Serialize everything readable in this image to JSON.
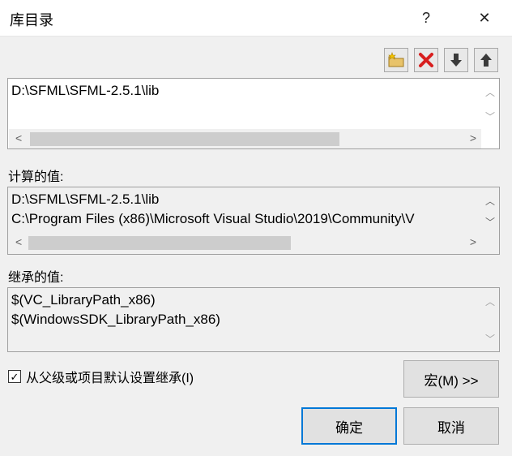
{
  "window": {
    "title": "库目录",
    "help_label": "?",
    "close_label": "✕"
  },
  "toolbar": {
    "icons": [
      "new-folder-icon",
      "delete-icon",
      "move-down-icon",
      "move-up-icon"
    ],
    "delete_color": "#d81e1e"
  },
  "edit_box": {
    "lines": [
      "D:\\SFML\\SFML-2.5.1\\lib"
    ]
  },
  "computed": {
    "label": "计算的值:",
    "lines": [
      "D:\\SFML\\SFML-2.5.1\\lib",
      "C:\\Program Files (x86)\\Microsoft Visual Studio\\2019\\Community\\V"
    ]
  },
  "inherited": {
    "label": "继承的值:",
    "lines": [
      "$(VC_LibraryPath_x86)",
      "$(WindowsSDK_LibraryPath_x86)"
    ]
  },
  "inherit_checkbox": {
    "label": "从父级或项目默认设置继承(I)",
    "checked": true,
    "mark": "✓"
  },
  "buttons": {
    "macro": "宏(M) >>",
    "ok": "确定",
    "cancel": "取消"
  },
  "accent_color": "#0078d7"
}
